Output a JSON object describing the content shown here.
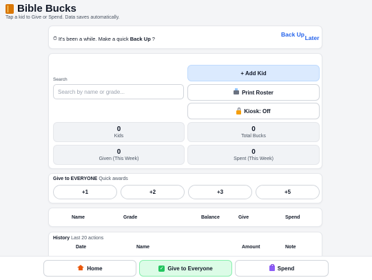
{
  "header": {
    "title": "Bible Bucks",
    "subtitle": "Tap a kid to Give or Spend. Data saves automatically."
  },
  "backup_banner": {
    "message_prefix": "It's been a while. Make a quick ",
    "message_bold": "Back Up",
    "message_suffix": "?",
    "backup_label": "Back Up",
    "later_label": "Later"
  },
  "search": {
    "label": "Search",
    "placeholder": "Search by name or grade...",
    "value": ""
  },
  "actions": {
    "add_kid": "+ Add Kid",
    "print_roster": "Print Roster",
    "kiosk": "Kiosk: Off"
  },
  "stats": {
    "kids": {
      "value": "0",
      "label": "Kids"
    },
    "total_bucks": {
      "value": "0",
      "label": "Total Bucks"
    },
    "given_week": {
      "value": "0",
      "label": "Given (This Week)"
    },
    "spent_week": {
      "value": "0",
      "label": "Spent (This Week)"
    }
  },
  "give_everyone": {
    "title": "Give to EVERYONE",
    "subtitle": "Quick awards",
    "amounts": [
      "+1",
      "+2",
      "+3",
      "+5"
    ]
  },
  "table": {
    "columns": [
      "Name",
      "Grade",
      "Balance",
      "Give",
      "Spend"
    ]
  },
  "history": {
    "title": "History",
    "subtitle": "Last 20 actions",
    "columns": [
      "Date",
      "Name",
      "Amount",
      "Note"
    ]
  },
  "bottom_nav": {
    "home": "Home",
    "give_everyone": "Give to Everyone",
    "spend": "Spend"
  },
  "colors": {
    "accent": "#2563eb",
    "add_kid_bg": "#dbeafe",
    "give_active_bg": "#dcfce7"
  }
}
